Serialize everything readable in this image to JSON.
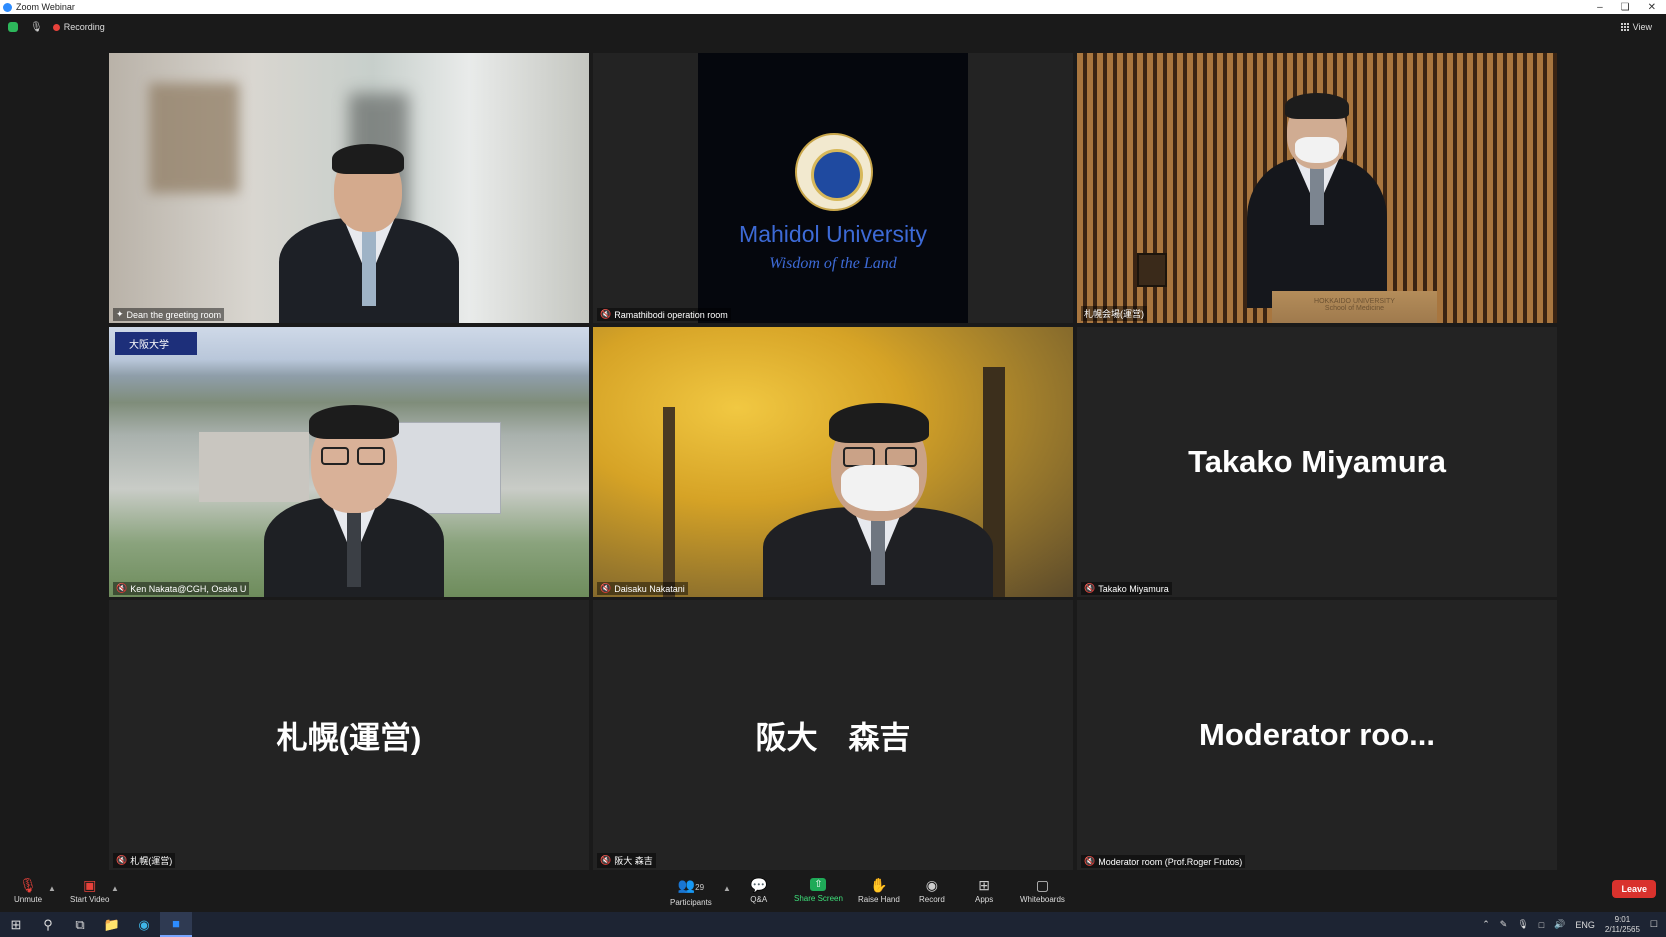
{
  "window": {
    "title": "Zoom Webinar"
  },
  "topbar": {
    "recording_label": "Recording",
    "view_label": "View"
  },
  "tiles": [
    {
      "name": "Dean the greeting room"
    },
    {
      "name": "Ramathibodi operation room",
      "logo_name": "Mahidol University",
      "logo_motto": "Wisdom of the Land"
    },
    {
      "name": "札幌会場(運営)",
      "podium_text_line1": "HOKKAIDO UNIVERSITY",
      "podium_text_line2": "School of Medicine"
    },
    {
      "name": "Ken Nakata@CGH, Osaka U",
      "banner_text": "大阪大学"
    },
    {
      "name": "Daisaku Nakatani"
    },
    {
      "name": "Takako Miyamura",
      "display_name": "Takako Miyamura"
    },
    {
      "name": "札幌(運営)",
      "display_name": "札幌(運営)"
    },
    {
      "name": "阪大 森吉",
      "display_name": "阪大　森吉"
    },
    {
      "name": "Moderator room (Prof.Roger Frutos)",
      "display_name": "Moderator roo..."
    }
  ],
  "toolbar": {
    "unmute": "Unmute",
    "start_video": "Start Video",
    "participants": "Participants",
    "participants_count": "29",
    "qa": "Q&A",
    "share_screen": "Share Screen",
    "raise_hand": "Raise Hand",
    "record": "Record",
    "apps": "Apps",
    "whiteboards": "Whiteboards",
    "leave": "Leave"
  },
  "taskbar": {
    "lang": "ENG",
    "time": "9:01",
    "date": "2/11/2565"
  },
  "colors": {
    "active_speaker": "#e3e877",
    "share_green": "#1faa58",
    "leave_red": "#d9322d",
    "mute_red": "#e8423b"
  }
}
